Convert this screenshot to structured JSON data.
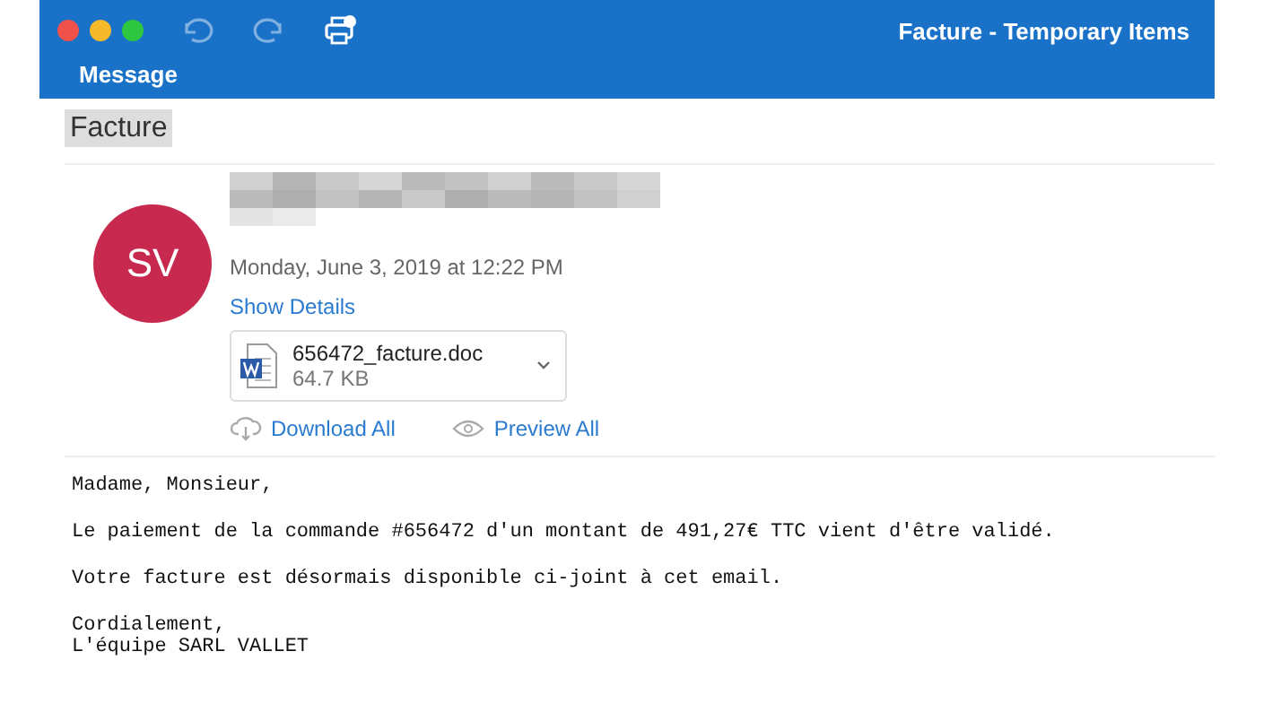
{
  "window": {
    "title": "Facture - Temporary Items"
  },
  "toolbar": {
    "tab": "Message"
  },
  "message": {
    "subject": "Facture",
    "avatar": "SV",
    "date": "Monday, June 3, 2019 at 12:22 PM",
    "show_details": "Show Details",
    "attachment": {
      "name": "656472_facture.doc",
      "size": "64.7 KB"
    },
    "actions": [
      "Download All",
      "Preview All"
    ],
    "body": [
      "Madame, Monsieur,",
      "Le paiement de la commande #656472 d'un montant de 491,27€ TTC vient d'être validé.",
      "Votre facture est désormais disponible ci-joint à cet email."
    ],
    "signature": [
      "Cordialement,",
      "L'équipe SARL VALLET"
    ]
  }
}
